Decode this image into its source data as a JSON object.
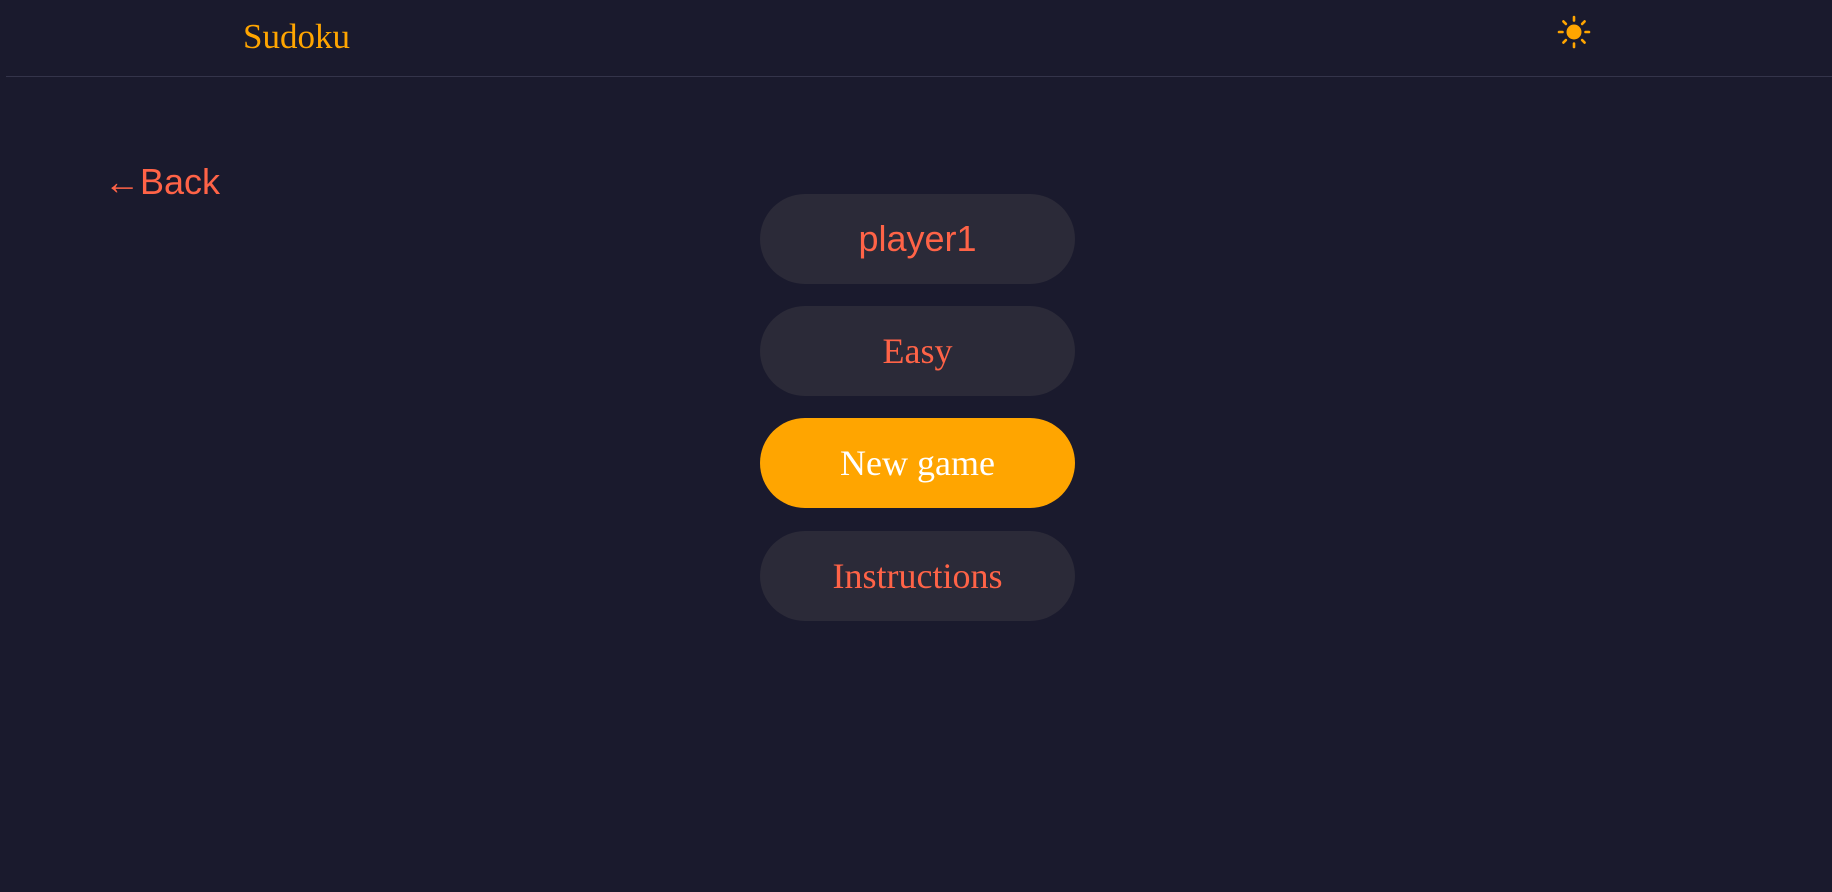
{
  "header": {
    "title": "Sudoku",
    "theme_icon": "sun-icon"
  },
  "nav": {
    "back_label": "←Back"
  },
  "menu": {
    "player_name": "player1",
    "difficulty": "Easy",
    "new_game_label": "New game",
    "instructions_label": "Instructions"
  },
  "colors": {
    "background": "#1a1a2d",
    "accent": "#ffa500",
    "text_accent": "#ff6347",
    "button_bg": "#2b2a38",
    "divider": "#34344a"
  }
}
